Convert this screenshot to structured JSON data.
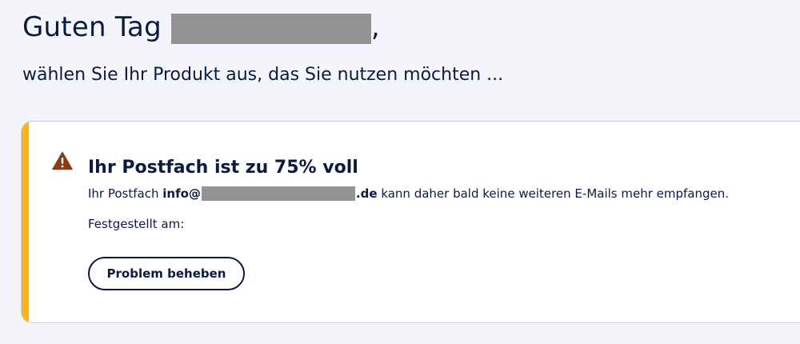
{
  "header": {
    "greeting_prefix": "Guten Tag",
    "greeting_suffix": ",",
    "subtitle": "wählen Sie Ihr Produkt aus, das Sie nutzen möchten ..."
  },
  "alert": {
    "icon": "warning-triangle-icon",
    "icon_color": "#8a3d12",
    "accent_color": "#fbb316",
    "title": "Ihr Postfach ist zu 75% voll",
    "body_prefix": "Ihr Postfach",
    "email_start": "info@",
    "email_end": ".de",
    "body_suffix": "kann daher bald keine weiteren E-Mails mehr empfangen.",
    "detected_label": "Festgestellt am:",
    "button_label": "Problem beheben"
  }
}
